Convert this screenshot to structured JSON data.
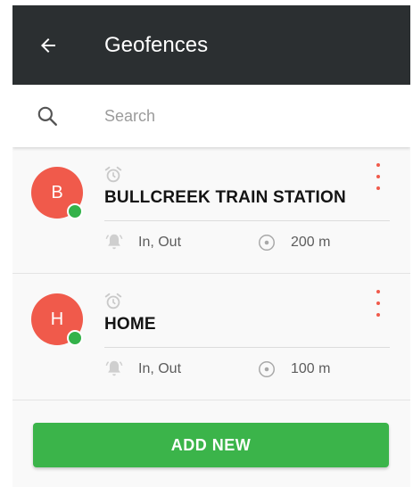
{
  "appbar": {
    "title": "Geofences",
    "back_icon": "arrow-left-icon"
  },
  "search": {
    "placeholder": "Search",
    "value": "",
    "icon": "search-icon"
  },
  "geofences": [
    {
      "initial": "B",
      "name": "BULLCREEK TRAIN STATION",
      "triggers": "In, Out",
      "radius": "200 m",
      "status": "active"
    },
    {
      "initial": "H",
      "name": "HOME",
      "triggers": "In, Out",
      "radius": "100 m",
      "status": "active"
    }
  ],
  "actions": {
    "add_label": "ADD NEW"
  },
  "colors": {
    "appbar": "#2b2f31",
    "avatar": "#f05a4b",
    "status_dot": "#34b24a",
    "accent_menu": "#f05a4b",
    "add_button": "#3bb44a"
  }
}
